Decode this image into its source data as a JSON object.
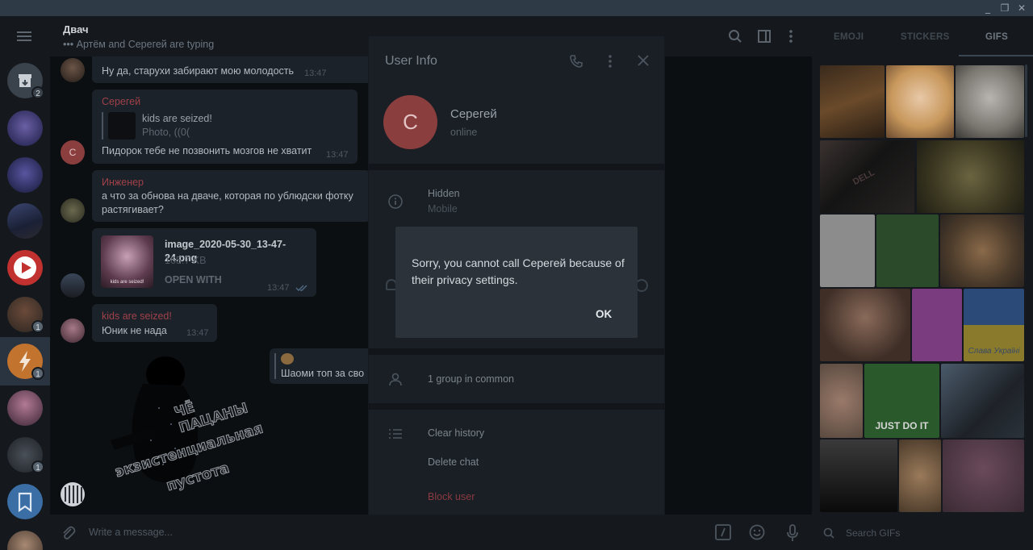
{
  "window": {
    "minimize": "_",
    "maximize": "❐",
    "close": "✕"
  },
  "chat": {
    "title": "Двач",
    "status": "••• Артём and Серегей are typing"
  },
  "folders": {
    "badges": [
      "2",
      "1",
      "1",
      "1"
    ]
  },
  "messages": [
    {
      "text": "Ну да, старухи забирают мою молодость",
      "time": "13:47"
    },
    {
      "sender": "Серегей",
      "reply_title": "kids are seized!",
      "reply_sub": "Photo, ((0(",
      "text": "Пидорок тебе не позвонить мозгов не хватит",
      "time": "13:47",
      "avatar_letter": "С"
    },
    {
      "sender": "Инженер",
      "text_line1": "а что за обнова на дваче, которая по ублюдски фотку",
      "text_line2": "растягивает?"
    },
    {
      "file_name": "image_2020-05-30_13-47-24.png",
      "file_size": "165.7 KB",
      "file_action": "OPEN WITH",
      "time": "13:47",
      "thumb_caption": "kids are seized!"
    },
    {
      "sender": "kids are seized!",
      "text": "Юник не нада",
      "time": "13:47"
    },
    {
      "text": "Шаоми топ за сво"
    }
  ],
  "sticker": {
    "line1": "ЧЁ ПАЦАНЫ",
    "line2": "экзистенциальная",
    "line3": "пустота"
  },
  "composer": {
    "placeholder": "Write a message..."
  },
  "right_panel": {
    "tabs": [
      "EMOJI",
      "STICKERS",
      "GIFS"
    ],
    "search_placeholder": "Search GIFs",
    "gif_captions": {
      "dell": "DELL",
      "justdoit": "JUST DO IT",
      "ukraine": "Слава Україні"
    }
  },
  "user_info": {
    "title": "User Info",
    "avatar_letter": "С",
    "name": "Серегей",
    "status": "online",
    "phone_label": "Hidden",
    "phone_sub": "Mobile",
    "groups_in_common": "1 group in common",
    "clear_history": "Clear history",
    "delete_chat": "Delete chat",
    "block_user": "Block user"
  },
  "dialog": {
    "text": "Sorry, you cannot call Серегей because of their privacy settings.",
    "ok": "OK"
  }
}
